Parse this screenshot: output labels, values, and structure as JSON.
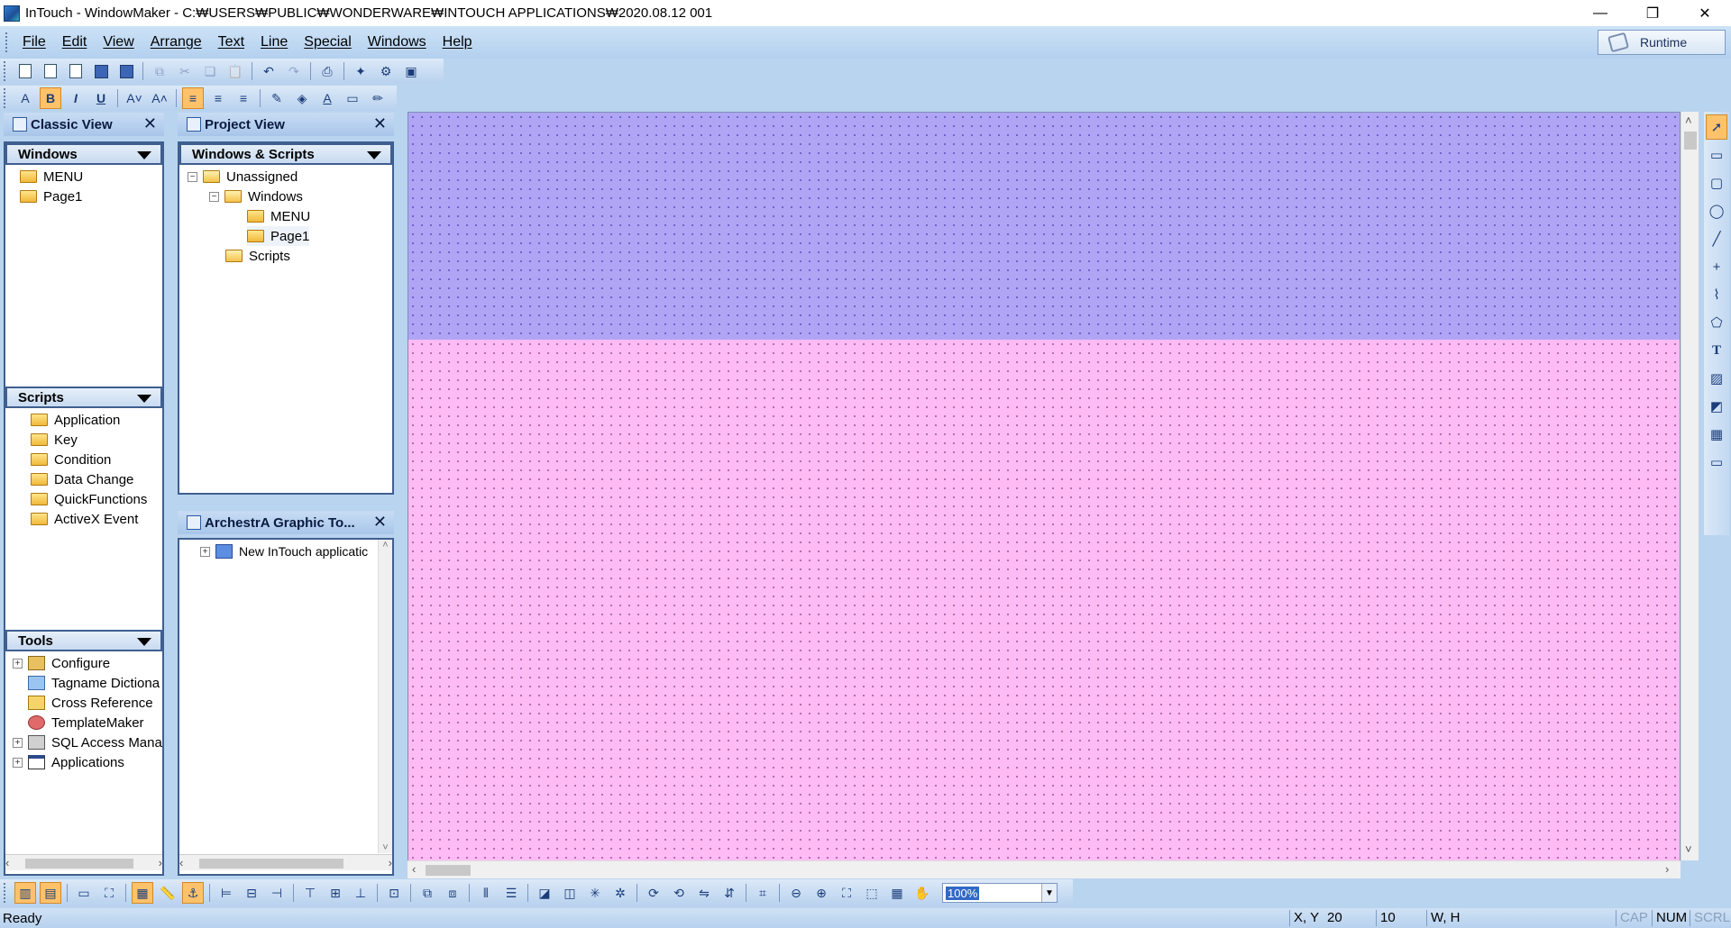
{
  "window": {
    "title": "InTouch - WindowMaker - C:₩USERS₩PUBLIC₩WONDERWARE₩INTOUCH APPLICATIONS₩2020.08.12 001",
    "minimize": "—",
    "restore": "❐",
    "close": "✕"
  },
  "menu": {
    "items": [
      "File",
      "Edit",
      "View",
      "Arrange",
      "Text",
      "Line",
      "Special",
      "Windows",
      "Help"
    ]
  },
  "runtime_label": "Runtime",
  "toolbar_format": {
    "bold": "B",
    "italic": "I",
    "underline": "U"
  },
  "classic_view": {
    "title": "Classic View",
    "windows_section": "Windows",
    "windows": [
      "MENU",
      "Page1"
    ],
    "scripts_section": "Scripts",
    "scripts": [
      "Application",
      "Key",
      "Condition",
      "Data Change",
      "QuickFunctions",
      "ActiveX Event"
    ],
    "tools_section": "Tools",
    "tools": [
      "Configure",
      "Tagname Dictiona",
      "Cross Reference",
      "TemplateMaker",
      "SQL Access Mana",
      "Applications"
    ]
  },
  "project_view": {
    "title": "Project View",
    "section": "Windows & Scripts",
    "unassigned": "Unassigned",
    "windows_folder": "Windows",
    "windows": [
      "MENU",
      "Page1"
    ],
    "scripts_folder": "Scripts"
  },
  "archestra": {
    "title": "ArchestrA Graphic To...",
    "root": "New InTouch applicatic"
  },
  "zoom": "100%",
  "status": {
    "ready": "Ready",
    "xy_label": "X, Y",
    "x": "20",
    "y": "10",
    "wh_label": "W, H",
    "cap": "CAP",
    "num": "NUM",
    "scrl": "SCRL"
  },
  "colors": {
    "canvas_top": "#b0a5f5",
    "canvas_bottom": "#ffbbf4",
    "chrome": "#b9d4ee",
    "active_tool": "#ffc26b"
  }
}
